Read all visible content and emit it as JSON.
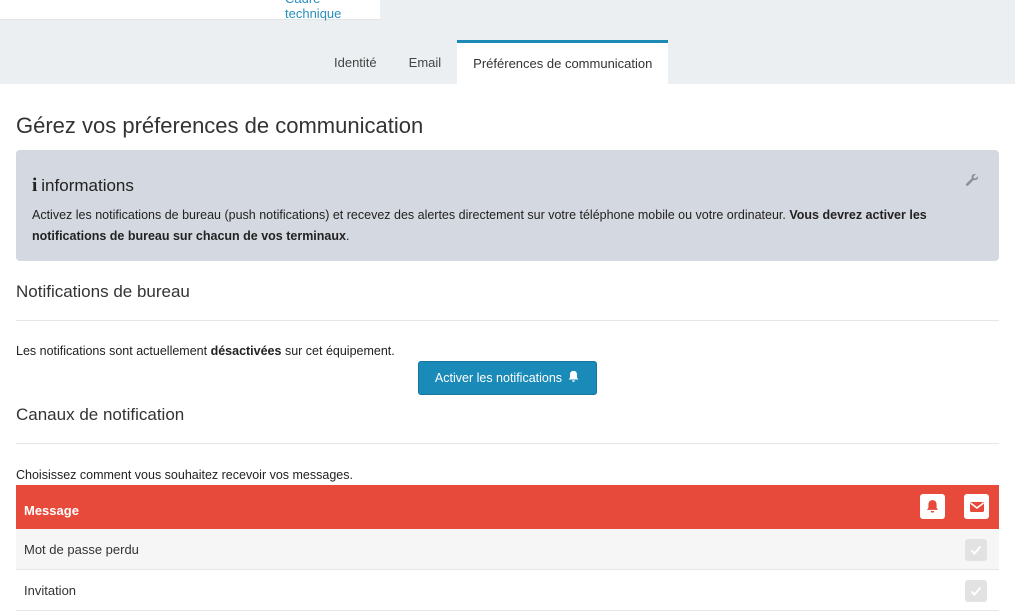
{
  "header": {
    "cut_link": "Cadre technique"
  },
  "tabs": [
    {
      "label": "Identité",
      "active": false
    },
    {
      "label": "Email",
      "active": false
    },
    {
      "label": "Préférences de communication",
      "active": true
    }
  ],
  "page": {
    "title": "Gérez vos préferences de communication"
  },
  "info": {
    "title": "informations",
    "text_normal": "Activez les notifications de bureau (push notifications) et recevez des alertes directement sur votre téléphone mobile ou votre ordinateur.",
    "text_bold": "Vous devrez activer les notifications de bureau sur chacun de vos terminaux",
    "text_end": "."
  },
  "desktop": {
    "title": "Notifications de bureau",
    "status_before": "Les notifications sont actuellement",
    "status_value": "désactivées",
    "status_after": "sur cet équipement.",
    "button_label": "Activer les notifications"
  },
  "channels": {
    "title": "Canaux de notification",
    "description": "Choisissez comment vous souhaitez recevoir vos messages.",
    "column_header": "Message",
    "rows": [
      {
        "label": "Mot de passe perdu"
      },
      {
        "label": "Invitation"
      }
    ]
  },
  "icons": {
    "info": "info-icon",
    "wrench": "wrench-icon",
    "bell": "bell-icon",
    "envelope": "envelope-icon",
    "check": "check-icon"
  },
  "colors": {
    "accent_blue": "#1a8ab8",
    "table_header_red": "#e74a3b",
    "info_bg": "#d4d8e0"
  }
}
